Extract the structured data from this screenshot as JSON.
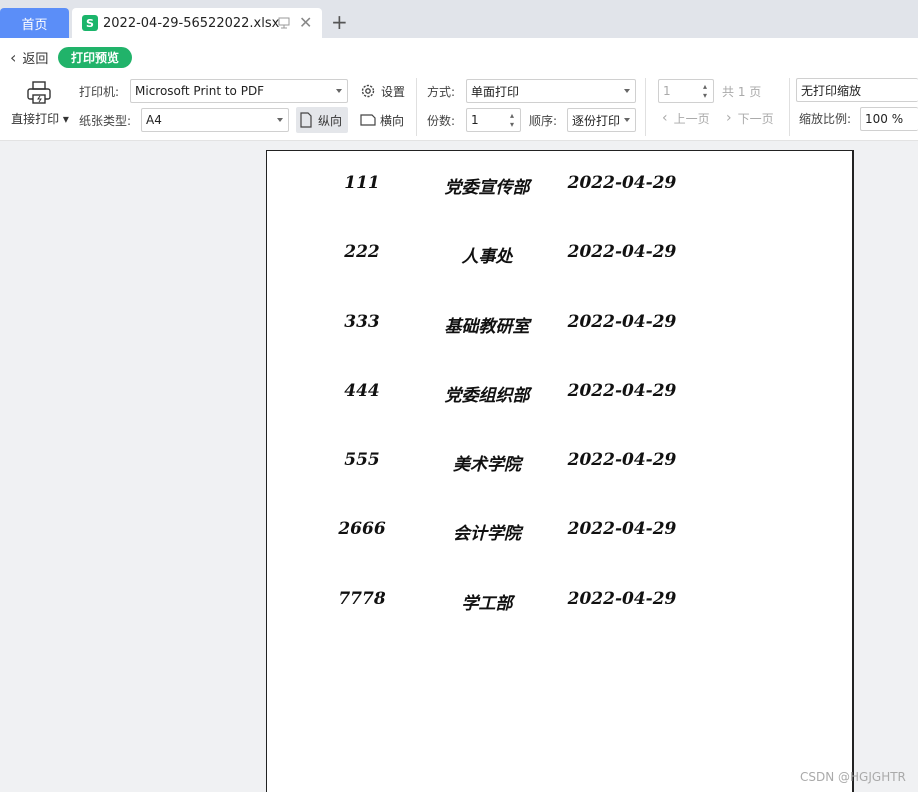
{
  "tabs": {
    "home": "首页",
    "file": "2022-04-29-56522022.xlsx",
    "file_icon": "S"
  },
  "header": {
    "back_label": "返回",
    "mode_badge": "打印预览"
  },
  "print": {
    "direct_print_label": "直接打印",
    "printer_label": "打印机:",
    "printer_value": "Microsoft Print to PDF",
    "settings_label": "设置",
    "paper_label": "纸张类型:",
    "paper_value": "A4",
    "portrait_label": "纵向",
    "landscape_label": "横向",
    "mode_label": "方式:",
    "mode_value": "单面打印",
    "copies_label": "份数:",
    "copies_value": "1",
    "order_label": "顺序:",
    "order_value": "逐份打印",
    "page_value": "1",
    "page_total": "共 1 页",
    "prev_page": "上一页",
    "next_page": "下一页",
    "scale_mode": "无打印缩放",
    "scale_label": "缩放比例:",
    "scale_value": "100 %"
  },
  "sheet": {
    "rows": [
      {
        "code": "111",
        "dept": "党委宣传部",
        "date": "2022-04-29"
      },
      {
        "code": "222",
        "dept": "人事处",
        "date": "2022-04-29"
      },
      {
        "code": "333",
        "dept": "基础教研室",
        "date": "2022-04-29"
      },
      {
        "code": "444",
        "dept": "党委组织部",
        "date": "2022-04-29"
      },
      {
        "code": "555",
        "dept": "美术学院",
        "date": "2022-04-29"
      },
      {
        "code": "2666",
        "dept": "会计学院",
        "date": "2022-04-29"
      },
      {
        "code": "7778",
        "dept": "学工部",
        "date": "2022-04-29"
      }
    ]
  },
  "watermark": "CSDN @HGJGHTR",
  "colors": {
    "home_tab": "#5b8ef8",
    "badge": "#21b36a",
    "xls_icon": "#1bb56b"
  }
}
